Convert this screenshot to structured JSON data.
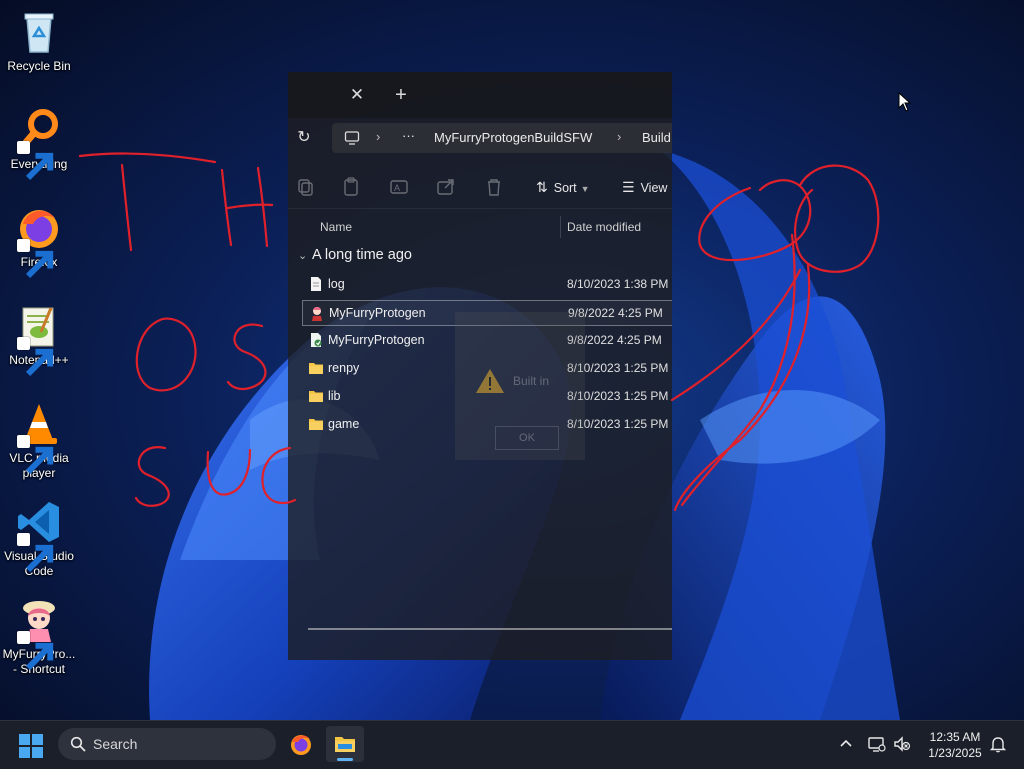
{
  "desktop": {
    "icons": [
      {
        "label": "Recycle Bin",
        "icon": "recycle-bin-icon"
      },
      {
        "label": "Everything",
        "icon": "everything-search-icon"
      },
      {
        "label": "Firefox",
        "icon": "firefox-icon"
      },
      {
        "label": "Notepad++",
        "icon": "notepad-plus-plus-icon"
      },
      {
        "label": "VLC media player",
        "icon": "vlc-icon"
      },
      {
        "label": "Visual Studio Code",
        "icon": "vscode-icon"
      },
      {
        "label": "MyFurryPro... - Shortcut",
        "icon": "myfurryprotogen-icon"
      }
    ]
  },
  "explorer": {
    "close_glyph": "✕",
    "new_tab_glyph": "+",
    "refresh_glyph": "↻",
    "breadcrumb": {
      "more": "···",
      "sep": "›",
      "folder": "MyFurryProtogenBuildSFW",
      "subfolder": "Build"
    },
    "toolbar": {
      "sort_label": "Sort",
      "view_label": "View"
    },
    "columns": {
      "name": "Name",
      "date": "Date modified"
    },
    "group_label": "A long time ago",
    "files": [
      {
        "name": "log",
        "date": "8/10/2023 1:38 PM",
        "type": "text-file",
        "selected": false
      },
      {
        "name": "MyFurryProtogen",
        "date": "9/8/2022 4:25 PM",
        "type": "app-exe",
        "selected": true
      },
      {
        "name": "MyFurryProtogen",
        "date": "9/8/2022 4:25 PM",
        "type": "script-file",
        "selected": false
      },
      {
        "name": "renpy",
        "date": "8/10/2023 1:25 PM",
        "type": "folder",
        "selected": false
      },
      {
        "name": "lib",
        "date": "8/10/2023 1:25 PM",
        "type": "folder",
        "selected": false
      },
      {
        "name": "game",
        "date": "8/10/2023 1:25 PM",
        "type": "folder",
        "selected": false
      }
    ],
    "ghost_dialog": {
      "text": "Built in",
      "button": "OK"
    }
  },
  "taskbar": {
    "search_placeholder": "Search",
    "apps": [
      "firefox-icon",
      "file-explorer-icon"
    ],
    "clock": {
      "time": "12:35 AM",
      "date": "1/23/2025"
    }
  },
  "colors": {
    "accent": "#5fb2f2",
    "scribble": "#e0202a",
    "folder": "#f4c542"
  }
}
